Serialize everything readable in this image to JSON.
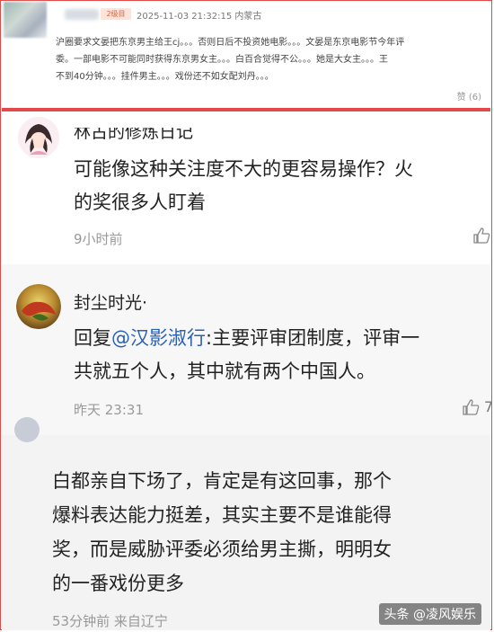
{
  "snippet": {
    "badge": "2级目",
    "meta": "2025-11-03 21:32:15 内蒙古",
    "lines": [
      "沪圈要求文晏把东京男主给王cj。。。否则日后不投资她电影。。。文晏是东京电影节今年评",
      "委。一部电影不可能同时获得东京男女主。。。白百合觉得不公。。。她是大女主。。。王",
      "不到40分钟。。。挂件男主。。。戏份还不如女配刘丹。。。"
    ],
    "zan": "赞 (6)"
  },
  "comments": [
    {
      "name": "林古的修炼日记",
      "text_l1": "可能像这种关注度不大的更容易操作？火",
      "text_l2": "的奖很多人盯着",
      "time": "9小时前",
      "likes": ""
    },
    {
      "name": "封尘时光·",
      "reply_prefix": "回复",
      "mention": "@汉影淑行",
      "text_l1_rest": ":主要评审团制度，评审一",
      "text_l2": "共就五个人，其中就有两个中国人。",
      "time": "昨天 23:31",
      "likes": "7"
    },
    {
      "text_l1": "白都亲自下场了，肯定是有这回事，那个",
      "text_l2": "爆料表达能力挺差，其实主要不是谁能得",
      "text_l3": "奖，而是威胁评委必须给男主撕，明明女",
      "text_l4": "的一番戏份更多",
      "time": "53分钟前  来自辽宁"
    }
  ],
  "watermark": "头条 @凌风娱乐",
  "colors": {
    "frame": "#e24a4a",
    "mention": "#2a62b3"
  }
}
